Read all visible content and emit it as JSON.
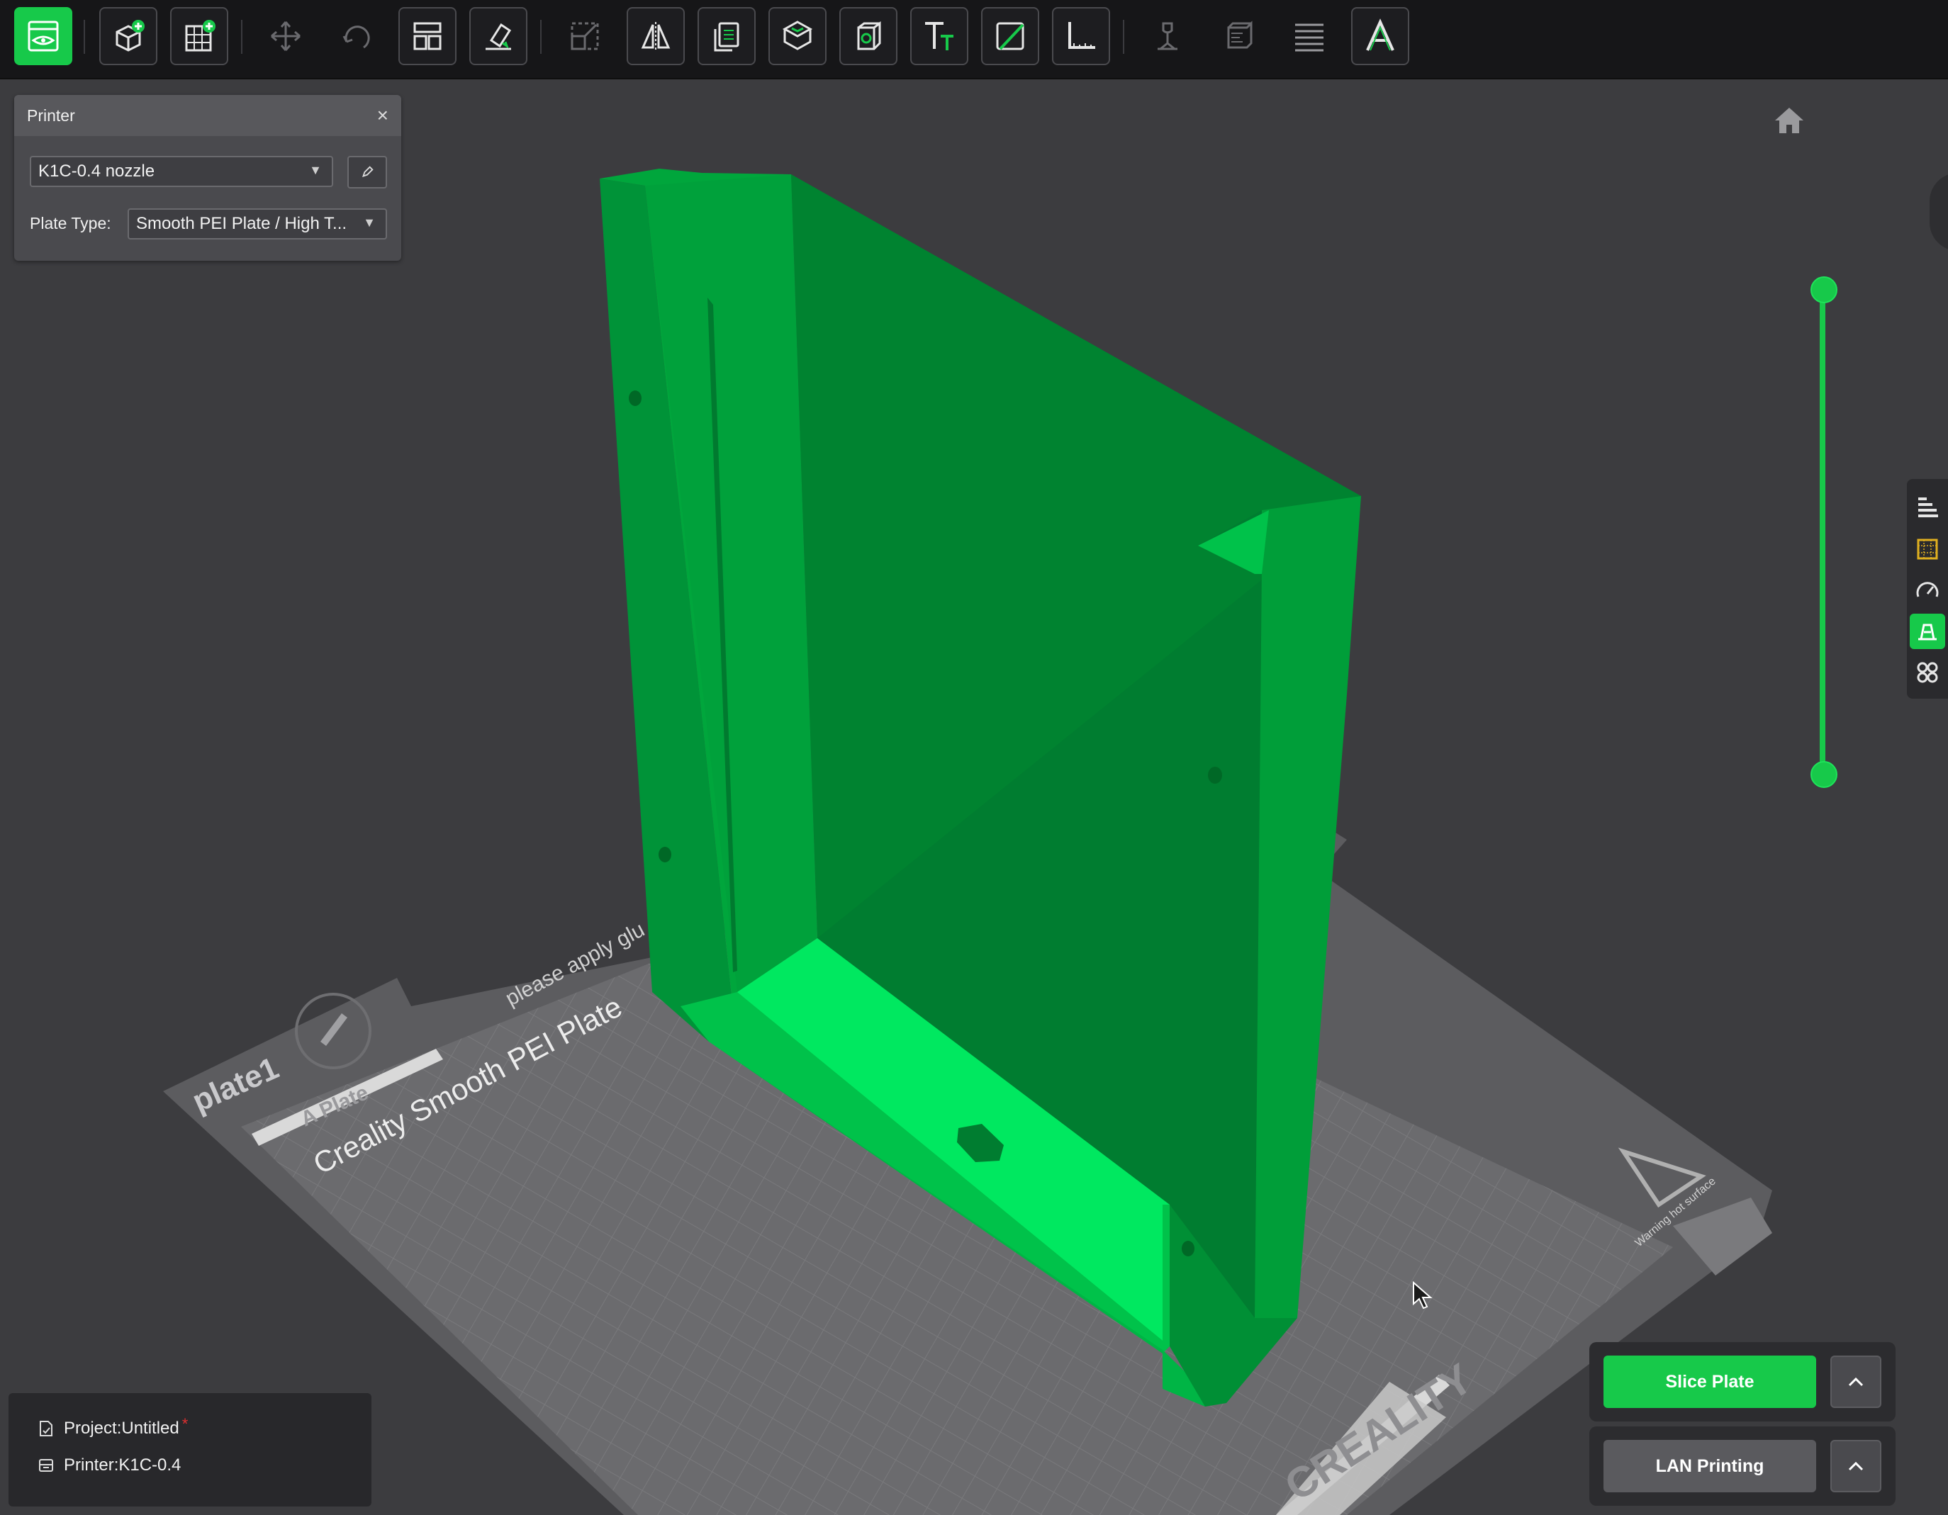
{
  "colors": {
    "accent": "#17c94a",
    "model": "#00a63c",
    "bed": "#6b6b6e",
    "background": "#3c3c3f"
  },
  "toolbar": {
    "tools": [
      {
        "name": "prepare",
        "icon": "plate-view-icon"
      },
      {
        "name": "add-object",
        "icon": "cube-add-icon"
      },
      {
        "name": "add-plate",
        "icon": "grid-plate-add-icon"
      },
      {
        "name": "move",
        "icon": "move-arrows-icon"
      },
      {
        "name": "rotate",
        "icon": "rotate-icon"
      },
      {
        "name": "arrange",
        "icon": "arrange-icon"
      },
      {
        "name": "lay-on-face",
        "icon": "lay-on-face-icon"
      },
      {
        "name": "scale",
        "icon": "scale-icon"
      },
      {
        "name": "mirror",
        "icon": "mirror-icon"
      },
      {
        "name": "copy",
        "icon": "copy-icon"
      },
      {
        "name": "support-paint",
        "icon": "support-paint-icon"
      },
      {
        "name": "hollow",
        "icon": "hollow-icon"
      },
      {
        "name": "text",
        "icon": "text-tool-icon"
      },
      {
        "name": "cut",
        "icon": "cut-icon"
      },
      {
        "name": "measure",
        "icon": "measure-icon"
      },
      {
        "name": "seam-paint",
        "icon": "seam-paint-icon"
      },
      {
        "name": "variable-layer",
        "icon": "variable-layer-icon"
      },
      {
        "name": "layers",
        "icon": "layers-icon"
      },
      {
        "name": "emboss",
        "icon": "emboss-text-icon"
      }
    ]
  },
  "printer_panel": {
    "title": "Printer",
    "printer": "K1C-0.4 nozzle",
    "plate_type_label": "Plate Type:",
    "plate_type": "Smooth PEI Plate / High T..."
  },
  "bed": {
    "plate_name": "plate1",
    "tag": "A Plate",
    "plate_title": "Creality Smooth PEI Plate",
    "note": "please apply glu",
    "brand": "CREALITY",
    "warning": "Warning hot surface"
  },
  "layer_slider": {
    "top": 1.0,
    "bottom": 0.0
  },
  "side_panel": {
    "items": [
      {
        "icon": "objects-list-icon",
        "active": false
      },
      {
        "icon": "plate-bounds-icon",
        "active": false
      },
      {
        "icon": "speed-gauge-icon",
        "active": false
      },
      {
        "icon": "support-icon",
        "active": true
      },
      {
        "icon": "four-leaf-icon",
        "active": false
      }
    ]
  },
  "project": {
    "project_label": "Project:Untitled",
    "dirty_mark": "*",
    "printer_label": "Printer:K1C-0.4"
  },
  "actions": {
    "slice": "Slice Plate",
    "lan": "LAN Printing"
  }
}
